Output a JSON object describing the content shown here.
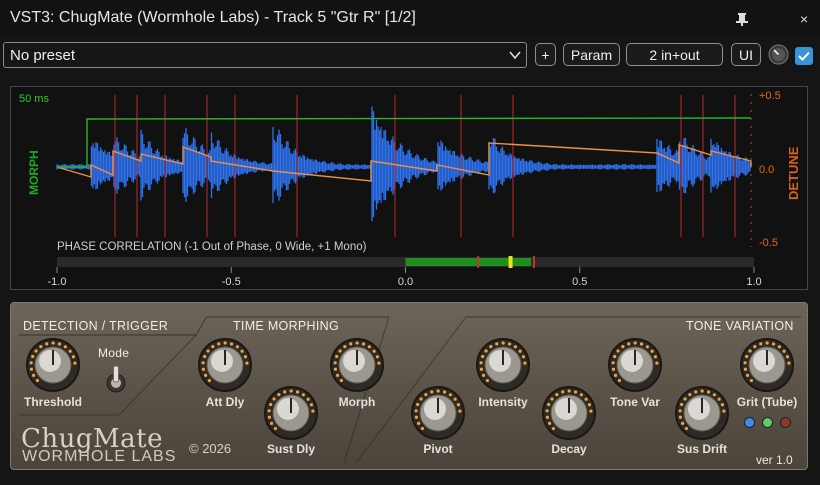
{
  "window": {
    "title": "VST3: ChugMate (Wormhole Labs) - Track 5 \"Gtr R\" [1/2]",
    "pin_icon": "pin-icon",
    "close_label": "×"
  },
  "toolbar": {
    "preset_value": "No preset",
    "plus_label": "+",
    "param_label": "Param",
    "io_label": "2 in+out",
    "ui_label": "UI",
    "wet_knob_icon": "dry-wet-knob-icon",
    "bypass_checked": true
  },
  "display": {
    "time_label": "50 ms",
    "left_axis_label": "MORPH",
    "right_axis_label": "DETUNE",
    "right_ticks": [
      "+0.5",
      "0.0",
      "-0.5"
    ],
    "phase_label": "PHASE CORRELATION (-1 Out of Phase, 0 Wide, +1 Mono)",
    "phase_ticks": [
      "-1.0",
      "-0.5",
      "0.0",
      "0.5",
      "1.0"
    ],
    "phase_fill_range": [
      0.0,
      0.36
    ],
    "phase_markers": [
      0.21,
      0.3,
      0.37
    ],
    "colors": {
      "morph": "#1faa1f",
      "detune": "#e0611b",
      "waveform": "#2f72f0",
      "transient": "#b02a2a"
    }
  },
  "panel": {
    "sections": {
      "detection": "DETECTION / TRIGGER",
      "time": "TIME MORPHING",
      "tone": "TONE VARIATION"
    },
    "knobs": {
      "threshold": "Threshold",
      "att_dly": "Att Dly",
      "sust_dly": "Sust Dly",
      "morph": "Morph",
      "pivot": "Pivot",
      "intensity": "Intensity",
      "decay": "Decay",
      "tone_var": "Tone Var",
      "sus_drift": "Sus Drift",
      "grit": "Grit (Tube)"
    },
    "mode_label": "Mode",
    "brand_name": "ChugMate",
    "brand_company": "WORMHOLE LABS",
    "copyright": "© 2026",
    "version": "ver 1.0",
    "leds": [
      "#3a8de0",
      "#5fce6a",
      "#8a3a2f"
    ]
  }
}
